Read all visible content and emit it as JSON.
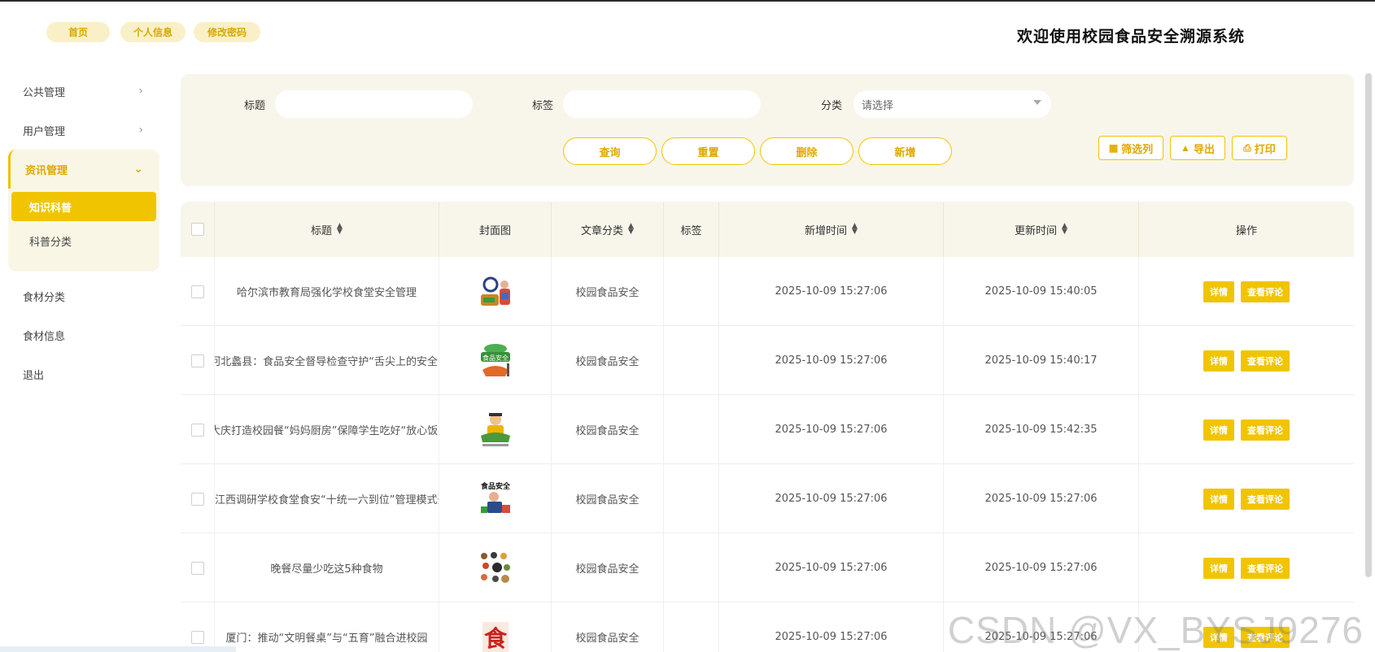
{
  "header": {
    "nav": [
      "首页",
      "个人信息",
      "修改密码"
    ],
    "title": "欢迎使用校园食品安全溯源系统"
  },
  "sidebar": {
    "items": [
      {
        "label": "公共管理",
        "chevron": "right"
      },
      {
        "label": "用户管理",
        "chevron": "right"
      },
      {
        "label": "资讯管理",
        "chevron": "down",
        "children": [
          "知识科普",
          "科普分类"
        ],
        "active_child": "知识科普"
      },
      {
        "label": "食材分类"
      },
      {
        "label": "食材信息"
      },
      {
        "label": "退出"
      }
    ]
  },
  "filters": {
    "title_label": "标题",
    "tag_label": "标签",
    "category_label": "分类",
    "category_placeholder": "请选择",
    "buttons": [
      "查询",
      "重置",
      "删除",
      "新增"
    ],
    "tools": [
      "筛选列",
      "导出",
      "打印"
    ]
  },
  "table": {
    "columns": [
      "标题",
      "封面图",
      "文章分类",
      "标签",
      "新增时间",
      "更新时间",
      "操作"
    ],
    "row_actions": [
      "详情",
      "查看评论"
    ],
    "rows": [
      {
        "title": "哈尔滨市教育局强化学校食堂安全管理",
        "category": "校园食品安全",
        "tag": "",
        "created": "2025-10-09 15:27:06",
        "updated": "2025-10-09 15:40:05"
      },
      {
        "title": "河北蠡县：食品安全督导检查守护“舌尖上的安全”",
        "category": "校园食品安全",
        "tag": "",
        "created": "2025-10-09 15:27:06",
        "updated": "2025-10-09 15:40:17"
      },
      {
        "title": "大庆打造校园餐“妈妈厨房”保障学生吃好“放心饭”",
        "category": "校园食品安全",
        "tag": "",
        "created": "2025-10-09 15:27:06",
        "updated": "2025-10-09 15:42:35"
      },
      {
        "title": "江西调研学校食堂食安“十统一六到位”管理模式开展情况",
        "category": "校园食品安全",
        "tag": "",
        "created": "2025-10-09 15:27:06",
        "updated": "2025-10-09 15:27:06"
      },
      {
        "title": "晚餐尽量少吃这5种食物",
        "category": "校园食品安全",
        "tag": "",
        "created": "2025-10-09 15:27:06",
        "updated": "2025-10-09 15:27:06"
      },
      {
        "title": "厦门：推动“文明餐桌”与“五育”融合进校园",
        "category": "校园食品安全",
        "tag": "",
        "created": "2025-10-09 15:27:06",
        "updated": "2025-10-09 15:27:06"
      }
    ]
  },
  "cover_texts": [
    "食品安全",
    "食品安全",
    "食"
  ],
  "watermark": "CSDN @VX_BYSJ9276",
  "colors": {
    "accent": "#f0c500",
    "accent_text": "#e0a800",
    "panel": "#f8f6ea"
  }
}
